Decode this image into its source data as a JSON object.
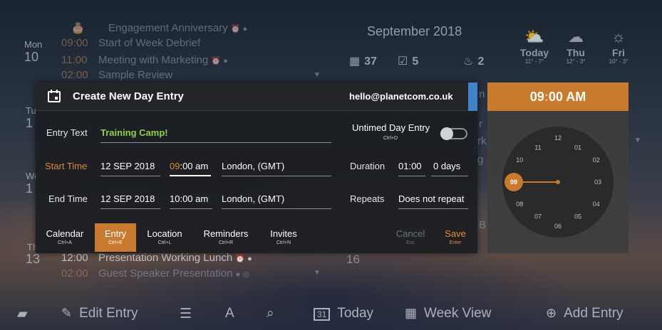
{
  "background": {
    "top_events": {
      "day_name": "Mon",
      "day_num": "10",
      "events": [
        {
          "time": "",
          "title": "Engagement Anniversary"
        },
        {
          "time": "09:00",
          "title": "Start of Week Debrief"
        },
        {
          "time": "11:00",
          "title": "Meeting with Marketing"
        },
        {
          "time": "02:00",
          "title": "Sample Review"
        }
      ]
    },
    "partial_days": [
      {
        "name": "Tu",
        "num": "1"
      },
      {
        "name": "We",
        "num": "1"
      }
    ],
    "bottom_events": {
      "day_name": "Th",
      "day_num": "13",
      "events": [
        {
          "time": "12:00",
          "title": "Presentation Working Lunch"
        },
        {
          "time": "02:00",
          "title": "Guest Speaker Presentation"
        }
      ]
    },
    "day16": "16",
    "month_title": "September 2018",
    "stats": [
      {
        "icon": "calendar-icon",
        "value": "37"
      },
      {
        "icon": "checkbox-icon",
        "value": "5"
      },
      {
        "icon": "cake-icon",
        "value": "2"
      }
    ],
    "weather": [
      {
        "day": "Today",
        "temp": "11° - 7°",
        "icon": "partly-cloudy-icon"
      },
      {
        "day": "Thu",
        "temp": "12° - 3°",
        "icon": "rain-cloud-icon"
      },
      {
        "day": "Fri",
        "temp": "10° - 3°",
        "icon": "sun-icon"
      }
    ],
    "peek_letters": [
      "n",
      "r",
      "rk",
      "g",
      "B"
    ]
  },
  "dialog": {
    "title": "Create New Day Entry",
    "email": "hello@planetcom.co.uk",
    "entry_text_label": "Entry Text",
    "entry_text_value": "Training Camp!",
    "untimed_label": "Untimed Day Entry",
    "untimed_shortcut": "Ctrl+D",
    "untimed_enabled": false,
    "start": {
      "label": "Start Time",
      "date": "12 SEP 2018",
      "hour": "09",
      "rest": ":00 am",
      "timezone": "London, (GMT)"
    },
    "end": {
      "label": "End Time",
      "date": "12 SEP 2018",
      "time": "10:00 am",
      "timezone": "London, (GMT)"
    },
    "duration": {
      "label": "Duration",
      "time": "01:00",
      "days": "0 days"
    },
    "repeats": {
      "label": "Repeats",
      "value": "Does not repeat"
    },
    "tabs": [
      {
        "label": "Calendar",
        "shortcut": "Ctrl+A"
      },
      {
        "label": "Entry",
        "shortcut": "Ctrl+E"
      },
      {
        "label": "Location",
        "shortcut": "Ctrl+L"
      },
      {
        "label": "Reminders",
        "shortcut": "Ctrl+R"
      },
      {
        "label": "Invites",
        "shortcut": "Ctrl+N"
      }
    ],
    "cancel": {
      "label": "Cancel",
      "shortcut": "Esc"
    },
    "save": {
      "label": "Save",
      "shortcut": "Enter"
    }
  },
  "clock": {
    "hour": "09",
    "minute": "00",
    "ampm": "AM",
    "numbers": [
      "12",
      "01",
      "02",
      "03",
      "04",
      "05",
      "06",
      "07",
      "08",
      "09",
      "10",
      "11"
    ],
    "selected": "09",
    "accent": "#c87a2e"
  },
  "toolbar": {
    "edit_entry": "Edit Entry",
    "today": "Today",
    "today_icon_day": "31",
    "week_view": "Week View",
    "add_entry": "Add Entry"
  },
  "colors": {
    "accent_orange": "#c87a2e",
    "entry_green": "#8fd14a",
    "scroll_blue": "#3f82c9"
  }
}
